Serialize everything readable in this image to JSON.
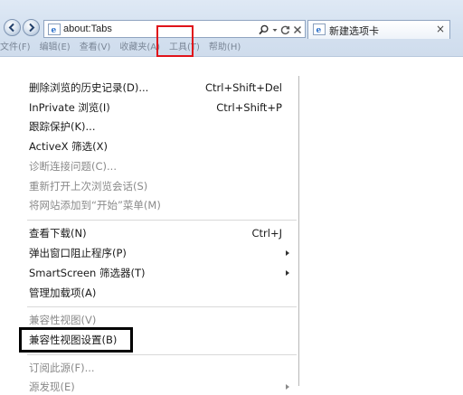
{
  "address_bar": {
    "url": "about:Tabs",
    "icons": [
      "ie-page-icon",
      "search-icon",
      "dropdown-arrow-icon",
      "refresh-icon",
      "close-icon"
    ]
  },
  "navigation": {
    "back_icon": "back-arrow-icon",
    "forward_icon": "forward-arrow-icon"
  },
  "tab": {
    "label": "新建选项卡",
    "close_glyph": "×"
  },
  "menubar": {
    "items": [
      {
        "label": "文件(F)"
      },
      {
        "label": "编辑(E)"
      },
      {
        "label": "查看(V)"
      },
      {
        "label": "收藏夹(A)"
      },
      {
        "label": "工具(T)"
      },
      {
        "label": "帮助(H)"
      }
    ],
    "highlighted": "工具(T)",
    "highlight_color": "#e0131a"
  },
  "tools_menu": {
    "items": [
      {
        "label": "删除浏览的历史记录(D)...",
        "shortcut": "Ctrl+Shift+Del",
        "enabled": true
      },
      {
        "label": "InPrivate 浏览(I)",
        "shortcut": "Ctrl+Shift+P",
        "enabled": true
      },
      {
        "label": "跟踪保护(K)...",
        "shortcut": "",
        "enabled": true
      },
      {
        "label": "ActiveX 筛选(X)",
        "shortcut": "",
        "enabled": true
      },
      {
        "label": "诊断连接问题(C)...",
        "shortcut": "",
        "enabled": false
      },
      {
        "label": "重新打开上次浏览会话(S)",
        "shortcut": "",
        "enabled": false
      },
      {
        "label": "将网站添加到“开始”菜单(M)",
        "shortcut": "",
        "enabled": false
      },
      {
        "label": "查看下载(N)",
        "shortcut": "Ctrl+J",
        "enabled": true
      },
      {
        "label": "弹出窗口阻止程序(P)",
        "shortcut": "",
        "enabled": true,
        "submenu": true
      },
      {
        "label": "SmartScreen 筛选器(T)",
        "shortcut": "",
        "enabled": true,
        "submenu": true
      },
      {
        "label": "管理加载项(A)",
        "shortcut": "",
        "enabled": true
      },
      {
        "label": "兼容性视图(V)",
        "shortcut": "",
        "enabled": false
      },
      {
        "label": "兼容性视图设置(B)",
        "shortcut": "",
        "enabled": true,
        "callout": true
      },
      {
        "label": "订阅此源(F)...",
        "shortcut": "",
        "enabled": false
      },
      {
        "label": "源发现(E)",
        "shortcut": "",
        "enabled": false,
        "submenu": true
      }
    ],
    "callout_color": "#000000"
  }
}
